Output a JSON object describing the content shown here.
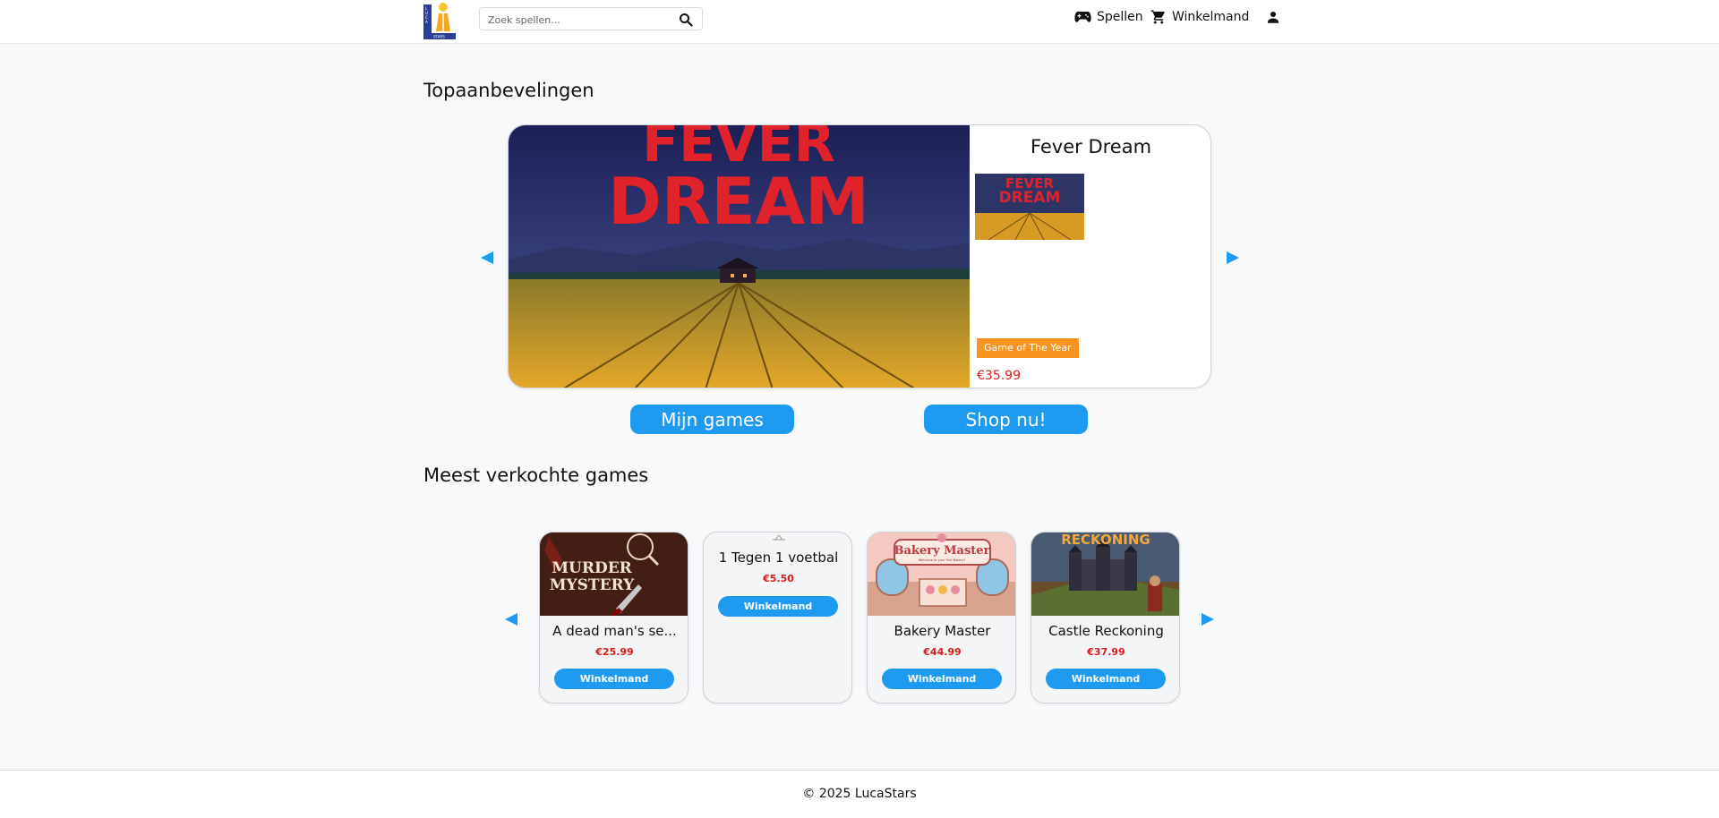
{
  "header": {
    "logo_alt": "LucaStars",
    "search_placeholder": "Zoek spellen...",
    "nav": {
      "games_label": "Spellen",
      "cart_label": "Winkelmand"
    }
  },
  "sections": {
    "top_title": "Topaanbevelingen",
    "bestsellers_title": "Meest verkochte games"
  },
  "featured": {
    "title": "Fever Dream",
    "art_text_line1": "FEVER",
    "art_text_line2": "DREAM",
    "badge": "Game of The Year",
    "price": "€35.99"
  },
  "actions": {
    "my_games": "Mijn games",
    "shop_now": "Shop nu!"
  },
  "bestsellers": [
    {
      "name": "A dead man's se...",
      "price": "€25.99",
      "button": "Winkelmand",
      "art_text": "MURDER MYSTERY"
    },
    {
      "name": "1 Tegen 1 voetbal",
      "price": "€5.50",
      "button": "Winkelmand"
    },
    {
      "name": "Bakery Master",
      "price": "€44.99",
      "button": "Winkelmand",
      "art_text": "Bakery Master"
    },
    {
      "name": "Castle Reckoning",
      "price": "€37.99",
      "button": "Winkelmand",
      "art_text": "RECKONING"
    }
  ],
  "footer": {
    "copyright": "© 2025 LucaStars"
  },
  "colors": {
    "accent": "#1e9bf0",
    "price": "#d71b1b",
    "badge": "#f7931e",
    "background": "#f8f9fb"
  }
}
